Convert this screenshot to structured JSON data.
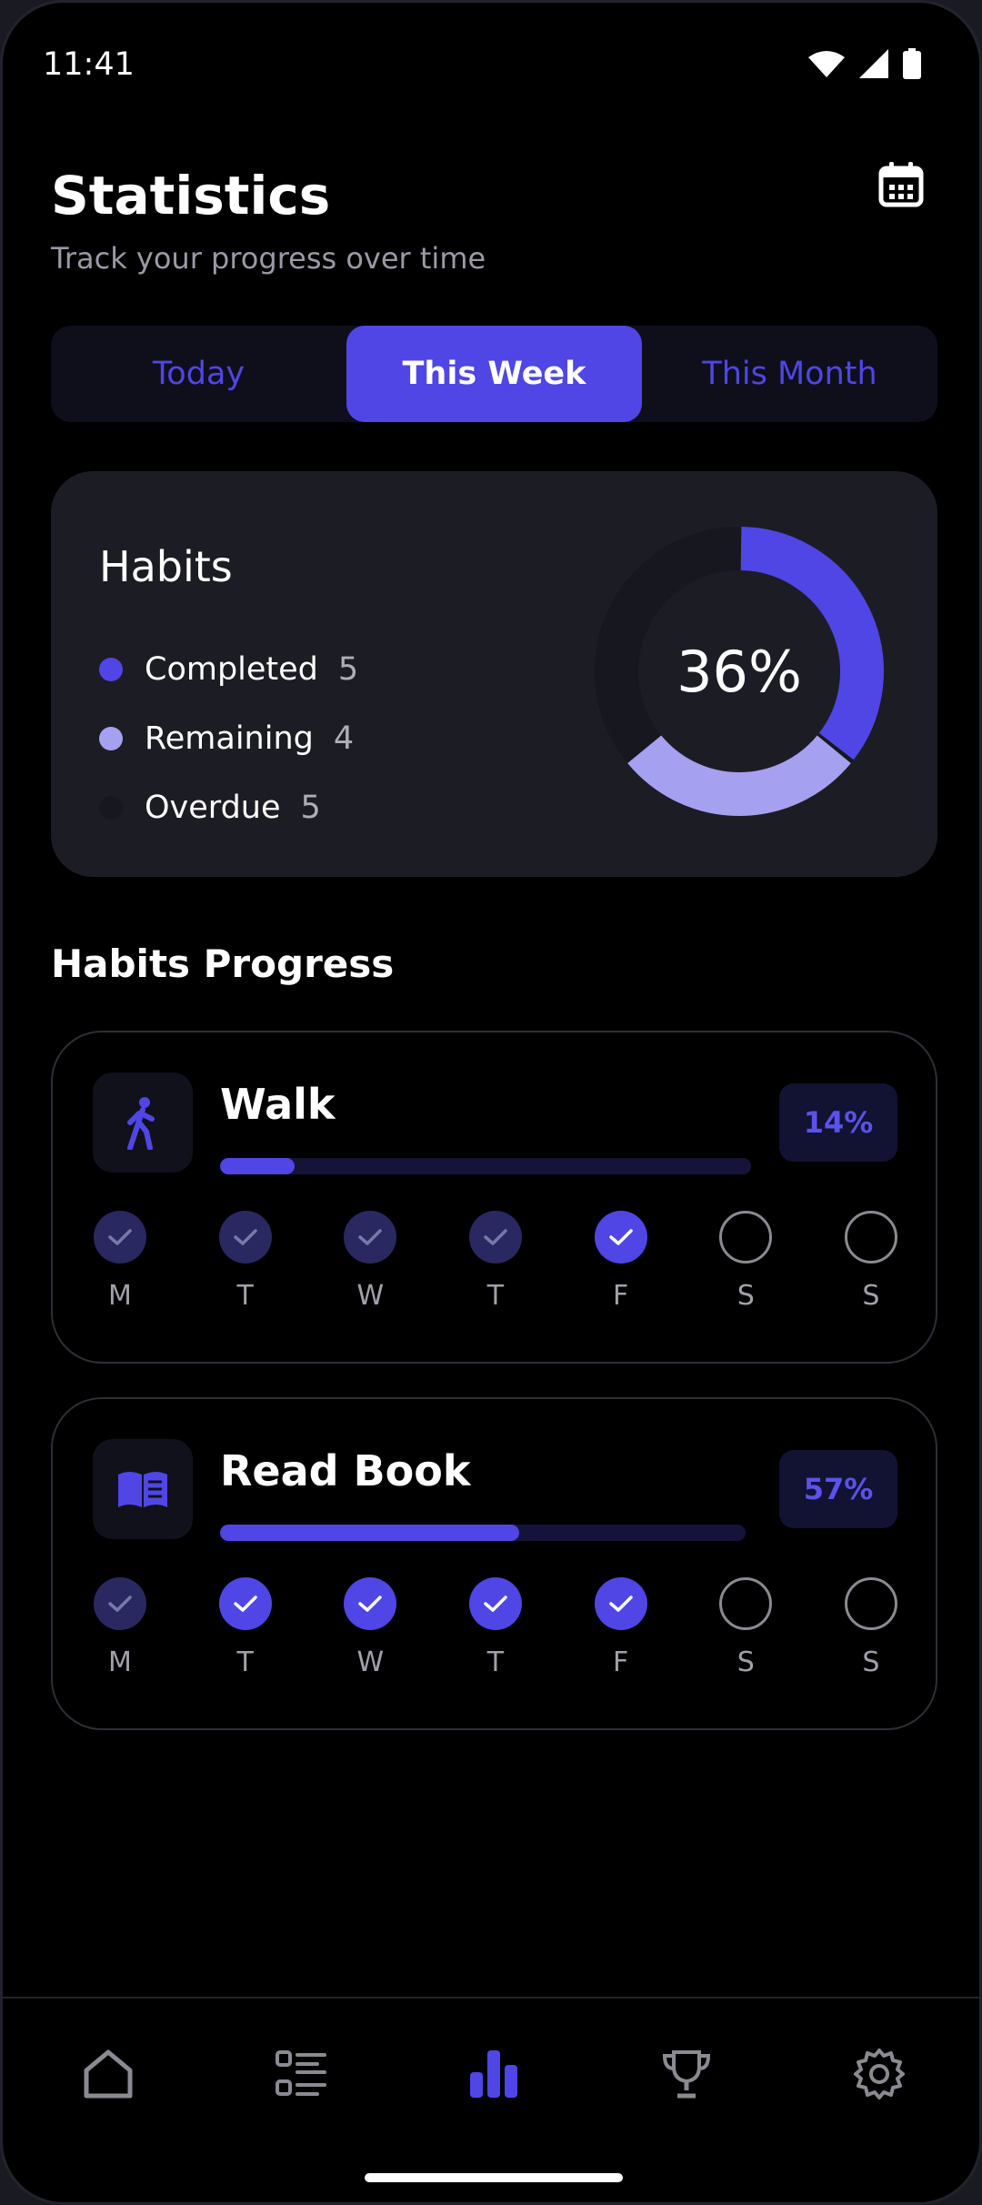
{
  "status": {
    "time": "11:41"
  },
  "header": {
    "title": "Statistics",
    "subtitle": "Track your progress over time",
    "calendar_icon": "calendar-icon"
  },
  "tabs": [
    {
      "label": "Today",
      "active": false
    },
    {
      "label": "This Week",
      "active": true
    },
    {
      "label": "This Month",
      "active": false
    }
  ],
  "summary": {
    "title": "Habits",
    "percent_label": "36%",
    "legend": [
      {
        "label": "Completed",
        "count": "5",
        "color": "#4f46e5"
      },
      {
        "label": "Remaining",
        "count": "4",
        "color": "#a5a0f0"
      },
      {
        "label": "Overdue",
        "count": "5",
        "color": "#17171f"
      }
    ]
  },
  "chart_data": {
    "type": "pie",
    "categories": [
      "Completed",
      "Remaining",
      "Overdue"
    ],
    "values": [
      5,
      4,
      5
    ],
    "center_label": "36%"
  },
  "progress_section": {
    "title": "Habits Progress"
  },
  "habits": [
    {
      "name": "Walk",
      "icon": "walking-person-icon",
      "percent_label": "14%",
      "progress": 0.14,
      "days": [
        {
          "label": "M",
          "state": "past"
        },
        {
          "label": "T",
          "state": "past"
        },
        {
          "label": "W",
          "state": "past"
        },
        {
          "label": "T",
          "state": "past"
        },
        {
          "label": "F",
          "state": "done"
        },
        {
          "label": "S",
          "state": "empty"
        },
        {
          "label": "S",
          "state": "empty"
        }
      ]
    },
    {
      "name": "Read Book",
      "icon": "book-icon",
      "percent_label": "57%",
      "progress": 0.57,
      "days": [
        {
          "label": "M",
          "state": "past"
        },
        {
          "label": "T",
          "state": "done"
        },
        {
          "label": "W",
          "state": "done"
        },
        {
          "label": "T",
          "state": "done"
        },
        {
          "label": "F",
          "state": "done"
        },
        {
          "label": "S",
          "state": "empty"
        },
        {
          "label": "S",
          "state": "empty"
        }
      ]
    }
  ],
  "nav": [
    {
      "icon": "home-icon",
      "active": false
    },
    {
      "icon": "checklist-icon",
      "active": false
    },
    {
      "icon": "bar-chart-icon",
      "active": true
    },
    {
      "icon": "trophy-icon",
      "active": false
    },
    {
      "icon": "settings-gear-icon",
      "active": false
    }
  ],
  "colors": {
    "accent": "#4f46e5",
    "accent_light": "#a5a0f0",
    "background": "#000000",
    "card": "#1c1c24"
  }
}
